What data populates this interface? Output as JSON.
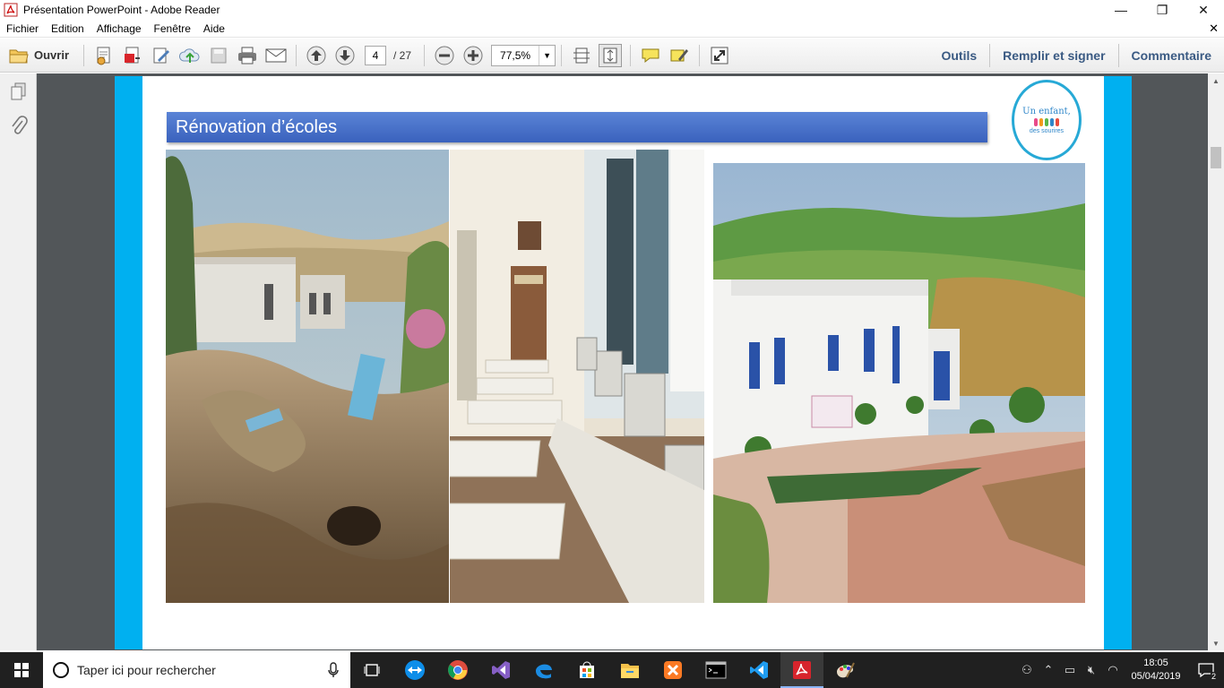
{
  "window": {
    "title": "Présentation PowerPoint - Adobe Reader",
    "minimize": "—",
    "maximize": "❐",
    "close": "✕"
  },
  "menu": {
    "items": [
      "Fichier",
      "Edition",
      "Affichage",
      "Fenêtre",
      "Aide"
    ],
    "close": "✕"
  },
  "toolbar": {
    "open_label": "Ouvrir",
    "current_page": "4",
    "total_pages": "/ 27",
    "zoom": "77,5%",
    "tools": "Outils",
    "fill_sign": "Remplir et signer",
    "comment": "Commentaire"
  },
  "slide": {
    "title": "Rénovation d’écoles",
    "logo_line1": "Un enfant,",
    "logo_line2": "des sourires"
  },
  "taskbar": {
    "search_placeholder": "Taper ici pour rechercher",
    "time": "18:05",
    "date": "05/04/2019",
    "notifications": "2"
  },
  "colors": {
    "accent_band": "#00b0f0",
    "title_bar": "#3f69c4",
    "doc_bg": "#525659",
    "taskbar": "#202020"
  }
}
